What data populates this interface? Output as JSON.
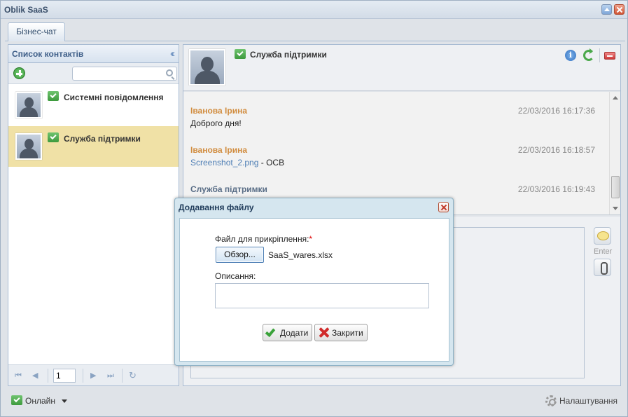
{
  "window": {
    "title": "Oblik SaaS"
  },
  "tabs": [
    {
      "label": "Бізнес-чат"
    }
  ],
  "contacts_panel": {
    "title": "Список контактів",
    "search": {
      "placeholder": "",
      "value": ""
    },
    "items": [
      {
        "name": "Системні повідомлення",
        "selected": false
      },
      {
        "name": "Служба підтримки",
        "selected": true
      }
    ],
    "pager": {
      "page": "1"
    }
  },
  "chat": {
    "contact_name": "Служба підтримки",
    "messages": [
      {
        "author": "Іванова Ірина",
        "time": "22/03/2016 16:17:36",
        "text": "Доброго дня!"
      },
      {
        "author": "Іванова Ірина",
        "time": "22/03/2016 16:18:57",
        "link": "Screenshot_2.png",
        "text_after": " - ОСВ"
      },
      {
        "author": "Служба підтримки",
        "time": "22/03/2016 16:19:43"
      }
    ],
    "enter_label": "Enter"
  },
  "dialog": {
    "title": "Додавання файлу",
    "file_label": "Файл для прикріплення:",
    "required_mark": "*",
    "browse_label": "Обзор...",
    "file_name": "SaaS_wares.xlsx",
    "description_label": "Описання:",
    "description_value": "",
    "add_label": "Додати",
    "close_label": "Закрити"
  },
  "footer": {
    "status_label": "Онлайн",
    "settings_label": "Налаштування"
  },
  "colors": {
    "author_user": "#d18c3e",
    "author_support": "#596d86",
    "selected_contact": "#f0e1a6"
  }
}
